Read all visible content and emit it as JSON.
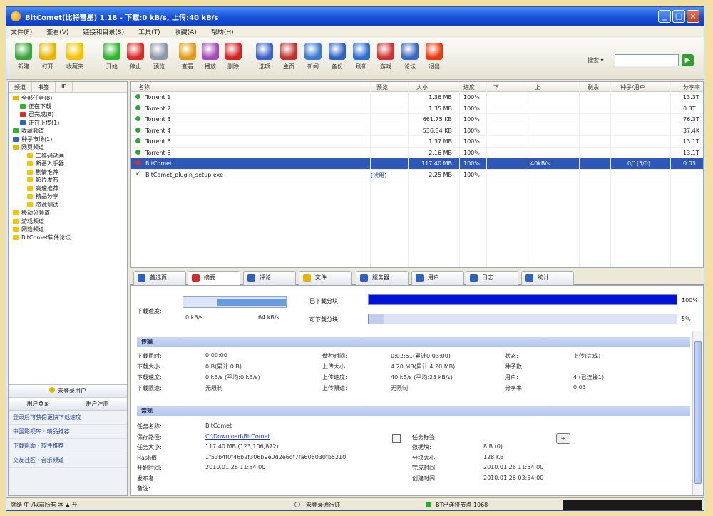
{
  "window": {
    "title": "BitComet(比特彗星) 1.18 - 下载:0 kB/s, 上传:40 kB/s"
  },
  "menu": [
    "文件(F)",
    "查看(V)",
    "链接和目录(S)",
    "工具(T)",
    "收藏(A)",
    "帮助(H)"
  ],
  "toolbar": [
    {
      "label": "新建",
      "icon": "new-icon",
      "color": "#3aa53a"
    },
    {
      "label": "打开",
      "icon": "open-icon",
      "color": "#e8b400"
    },
    {
      "label": "收藏夹",
      "icon": "star-icon",
      "color": "#f3c400"
    },
    {
      "label": "开始",
      "icon": "start-icon",
      "color": "#2db52d"
    },
    {
      "label": "停止",
      "icon": "stop-icon",
      "color": "#d82a2a"
    },
    {
      "label": "预览",
      "icon": "preview-icon",
      "color": "#8c97ab"
    },
    {
      "label": "查看",
      "icon": "view-icon",
      "color": "#e09a1a"
    },
    {
      "label": "播放",
      "icon": "play-icon",
      "color": "#a34ab8"
    },
    {
      "label": "删除",
      "icon": "delete-icon",
      "color": "#d82020"
    },
    {
      "label": "选项",
      "icon": "options-icon",
      "color": "#3a62c8"
    },
    {
      "label": "主页",
      "icon": "home-icon",
      "color": "#c43030"
    },
    {
      "label": "新闻",
      "icon": "news-icon",
      "color": "#3a7ad0"
    },
    {
      "label": "备份",
      "icon": "backup-icon",
      "color": "#2c62c4"
    },
    {
      "label": "刷新",
      "icon": "refresh-icon",
      "color": "#2e6cd0"
    },
    {
      "label": "游戏",
      "icon": "game-icon",
      "color": "#d03030"
    },
    {
      "label": "论坛",
      "icon": "forum-icon",
      "color": "#3a68c0"
    },
    {
      "label": "退出",
      "icon": "exit-icon",
      "color": "#e43a10"
    }
  ],
  "search": {
    "label": "搜索 ▾",
    "value": "",
    "go": "▶"
  },
  "sidebar": {
    "tabs": [
      "频道",
      "书签",
      "IE"
    ],
    "tree": [
      {
        "label": "全部任务(8)",
        "indent": 0,
        "color": "#e8b400"
      },
      {
        "label": "正在下载",
        "indent": 1,
        "color": "#2db52d"
      },
      {
        "label": "已完成(8)",
        "indent": 1,
        "color": "#d82a2a"
      },
      {
        "label": "正在上传(1)",
        "indent": 1,
        "color": "#2c62c4"
      },
      {
        "label": "收藏频道",
        "indent": 0,
        "color": "#2db52d"
      },
      {
        "label": "种子市场(1)",
        "indent": 0,
        "color": "#2c62c4"
      },
      {
        "label": "网页频道",
        "indent": 0,
        "color": "#e8b400"
      },
      {
        "label": "二维码动画",
        "indent": 2,
        "color": "#f3c400"
      },
      {
        "label": "新番入手器",
        "indent": 2,
        "color": "#f3c400"
      },
      {
        "label": "剧情推荐",
        "indent": 2,
        "color": "#f3c400"
      },
      {
        "label": "影片发布",
        "indent": 2,
        "color": "#f3c400"
      },
      {
        "label": "高速推荐",
        "indent": 2,
        "color": "#f3c400"
      },
      {
        "label": "精品分享",
        "indent": 2,
        "color": "#f3c400"
      },
      {
        "label": "资源测试",
        "indent": 2,
        "color": "#f3c400"
      },
      {
        "label": "移动分频道",
        "indent": 0,
        "color": "#f3c400"
      },
      {
        "label": "游戏频道",
        "indent": 0,
        "color": "#f3c400"
      },
      {
        "label": "网络频道",
        "indent": 0,
        "color": "#f3c400"
      },
      {
        "label": "BitComet软件论坛",
        "indent": 0,
        "color": "#f3c400"
      }
    ],
    "bottom": {
      "users_btn": "未登录用户",
      "login": "用户登录",
      "register": "用户注册",
      "links": [
        "登录后可获得更快下载速度",
        "中国影视库  ·  精品推荐",
        "下载帮助  ·  软件推荐",
        "交友社区  ·  音乐频道"
      ]
    }
  },
  "tasks": {
    "columns": [
      "名称",
      "预览",
      "大小",
      "进度",
      "下",
      "上",
      "剩余",
      "种子/用户",
      "分享率"
    ],
    "rows": [
      {
        "name": "Torrent 1",
        "preview": "",
        "size": "1.36 MB",
        "progress": "100%",
        "down": "",
        "up": "",
        "remain": "",
        "seeds": "",
        "ratio": "13.3T",
        "selected": false,
        "icon": "done"
      },
      {
        "name": "Torrent 2",
        "preview": "",
        "size": "1.35 MB",
        "progress": "100%",
        "down": "",
        "up": "",
        "remain": "",
        "seeds": "",
        "ratio": "0.3T",
        "selected": false,
        "icon": "done"
      },
      {
        "name": "Torrent 3",
        "preview": "",
        "size": "661.75 KB",
        "progress": "100%",
        "down": "",
        "up": "",
        "remain": "",
        "seeds": "",
        "ratio": "76.3T",
        "selected": false,
        "icon": "done"
      },
      {
        "name": "Torrent 4",
        "preview": "",
        "size": "536.34 KB",
        "progress": "100%",
        "down": "",
        "up": "",
        "remain": "",
        "seeds": "",
        "ratio": "37.4K",
        "selected": false,
        "icon": "done"
      },
      {
        "name": "Torrent 5",
        "preview": "",
        "size": "1.37 MB",
        "progress": "100%",
        "down": "",
        "up": "",
        "remain": "",
        "seeds": "",
        "ratio": "13.1T",
        "selected": false,
        "icon": "done"
      },
      {
        "name": "Torrent 6",
        "preview": "",
        "size": "2.16 MB",
        "progress": "100%",
        "down": "",
        "up": "",
        "remain": "",
        "seeds": "",
        "ratio": "13.1T",
        "selected": false,
        "icon": "done"
      },
      {
        "name": "BitComet",
        "preview": "",
        "size": "117.40 MB",
        "progress": "100%",
        "down": "",
        "up": "40kB/s",
        "remain": "",
        "seeds": "0/1(5/0)",
        "ratio": "0.03",
        "selected": true,
        "icon": "seeding"
      },
      {
        "name": "BitComet_plugin_setup.exe",
        "preview": "[试用]",
        "size": "2.25 MB",
        "progress": "100%",
        "down": "",
        "up": "",
        "remain": "",
        "seeds": "",
        "ratio": "",
        "selected": false,
        "icon": "check"
      }
    ]
  },
  "detail_tabs": [
    {
      "label": "首选页",
      "color": "#2c62c4"
    },
    {
      "label": "摘要",
      "color": "#d82a2a"
    },
    {
      "label": "评论",
      "color": "#2c62c4"
    },
    {
      "label": "文件",
      "color": "#e8b400"
    },
    {
      "label": "服务器",
      "color": "#2c62c4"
    },
    {
      "label": "用户",
      "color": "#2c62c4"
    },
    {
      "label": "日志",
      "color": "#2c62c4"
    },
    {
      "label": "统计",
      "color": "#2c62c4"
    }
  ],
  "summary": {
    "speed_label": "下载速度:",
    "speed_lo": "0 kB/s",
    "speed_hi": "64 kB/s",
    "downloaded_label": "已下载分块:",
    "available_label": "可下载分块:",
    "downloaded_pct": "100%",
    "available_pct": "5%",
    "downloaded_fraction": 1.0,
    "available_fraction": 0.05,
    "transfer_header": "传输",
    "transfer": [
      [
        "下载用时:",
        "0:00:00",
        "做种时间:",
        "0:02:51(累计0:03:00)",
        "状态:",
        "上传(完成)"
      ],
      [
        "下载大小:",
        "0 B(累计 0 B)",
        "上传大小:",
        "4.20 MB(累计 4.20 MB)",
        "种子数:",
        ""
      ],
      [
        "下载速度:",
        "0 kB/s (平均:0 kB/s)",
        "上传速度:",
        "40 kB/s (平均:23 kB/s)",
        "用户:",
        "4 (已连接1)"
      ],
      [
        "下载限速:",
        "无限制",
        "上传限速:",
        "无限制",
        "分享率:",
        "0.03"
      ]
    ],
    "info_header": "常规",
    "info": [
      [
        "任务名称:",
        "BitComet",
        "",
        ""
      ],
      [
        "保存路径:",
        "C:\\Download\\BitComet",
        "任务标签:",
        ""
      ],
      [
        "任务大小:",
        "117.40 MB (123,106,872)",
        "数据块:",
        "8 B (0)"
      ],
      [
        "Hash值:",
        "1f53b4f0f46b2f306b9e0d2e6df7fa606030fb5210",
        "分块大小:",
        "128 KB"
      ],
      [
        "开始时间:",
        "2010.01.26 11:54:00",
        "完成时间:",
        "2010.01.26 11:54:00"
      ],
      [
        "发布者:",
        "",
        "创建时间:",
        "2010.01.26 03:54:00"
      ],
      [
        "备注:",
        "",
        "",
        ""
      ]
    ]
  },
  "status": {
    "left": "就绪 中 /以前所有 本 ▲ 开",
    "middle": "未登录通行证",
    "right": "BT已连接节点 1068"
  }
}
